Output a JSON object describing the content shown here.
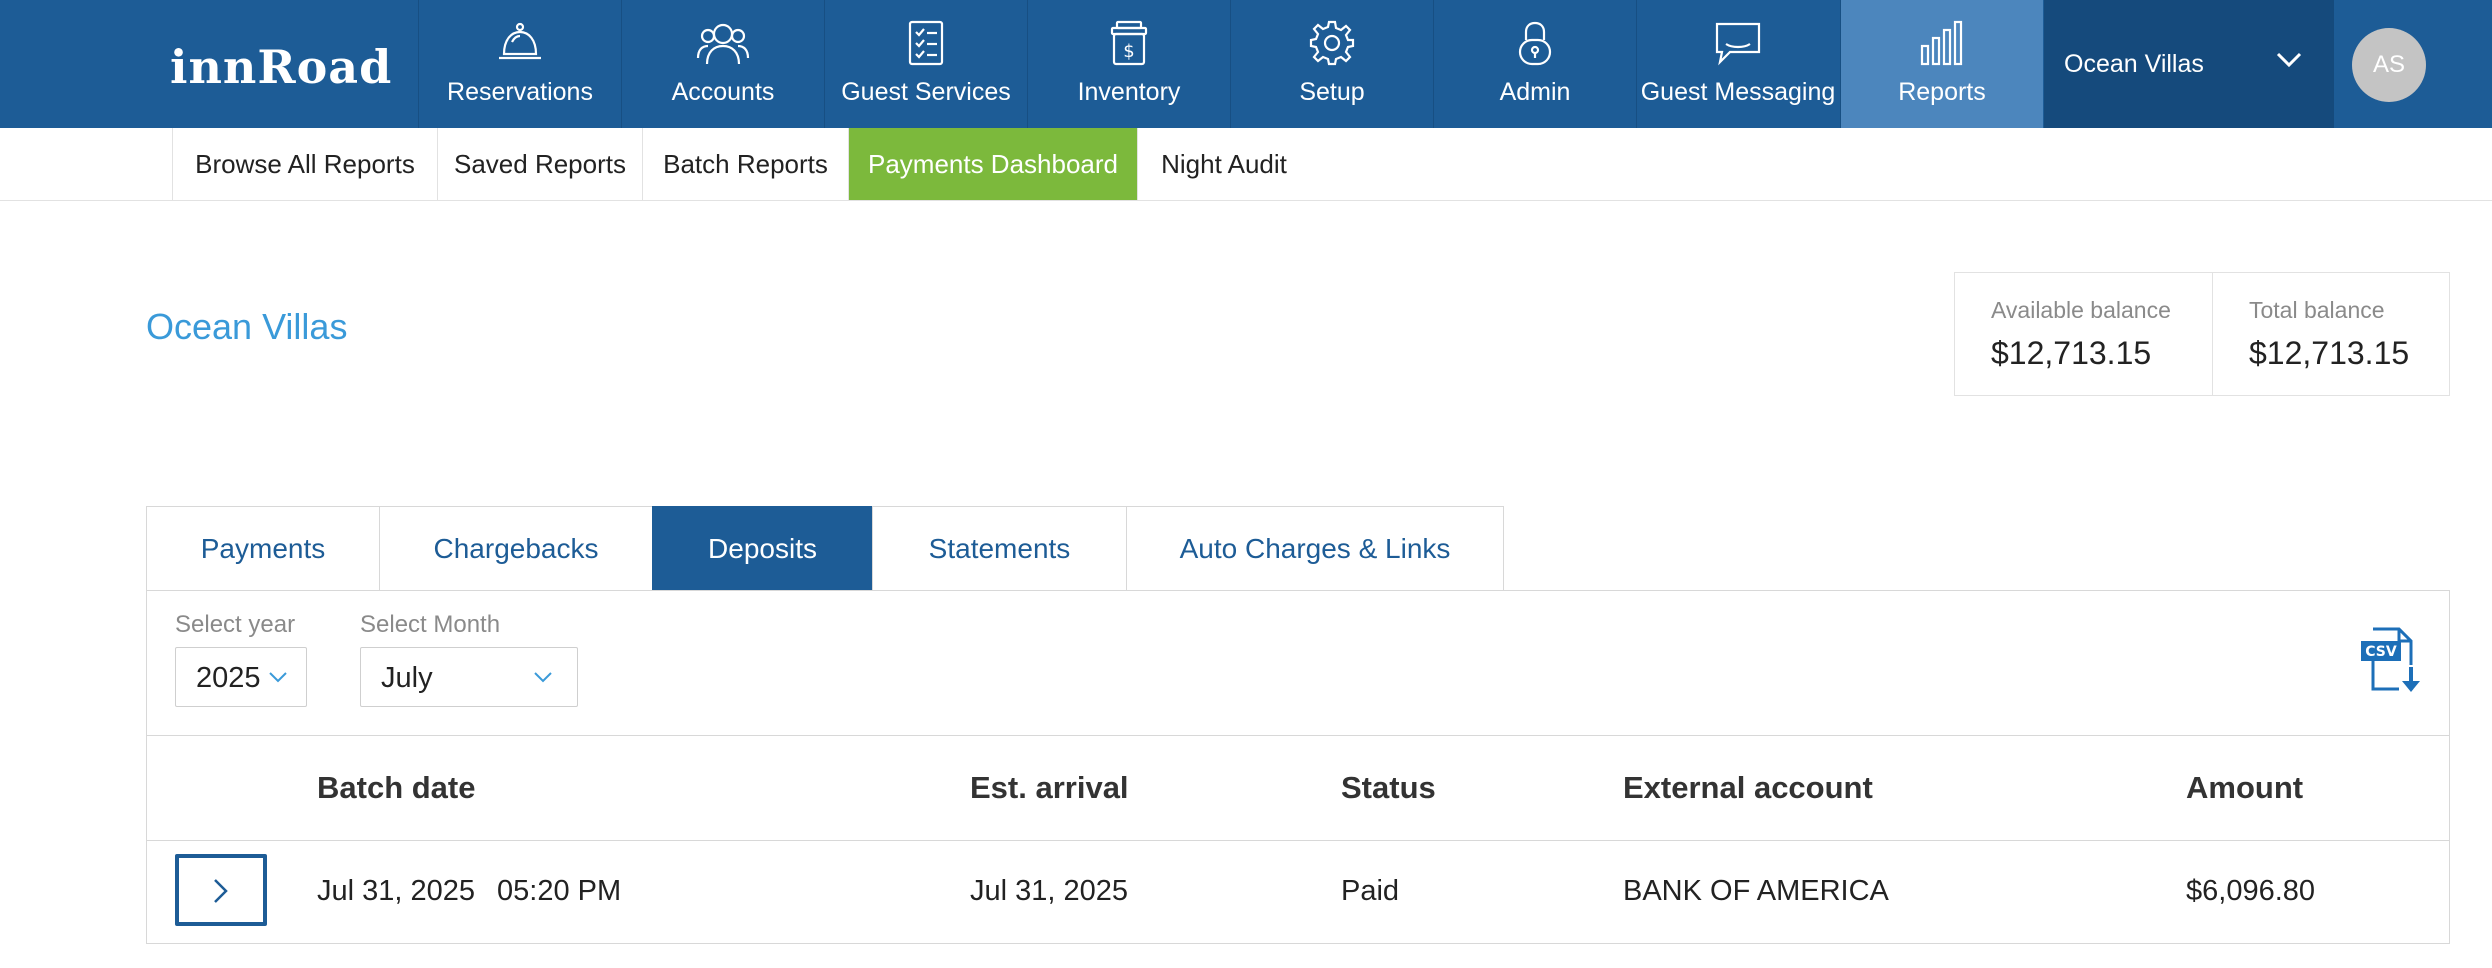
{
  "app": {
    "logo": "innRoad"
  },
  "nav": {
    "items": [
      {
        "label": "Reservations",
        "icon": "bell-icon"
      },
      {
        "label": "Accounts",
        "icon": "users-icon"
      },
      {
        "label": "Guest Services",
        "icon": "checklist-icon"
      },
      {
        "label": "Inventory",
        "icon": "jar-dollar-icon"
      },
      {
        "label": "Setup",
        "icon": "gear-icon"
      },
      {
        "label": "Admin",
        "icon": "lock-icon"
      },
      {
        "label": "Guest Messaging",
        "icon": "chat-icon"
      },
      {
        "label": "Reports",
        "icon": "bar-chart-icon",
        "active": true
      }
    ],
    "property": "Ocean Villas",
    "avatar_initials": "AS"
  },
  "subnav": {
    "items": [
      {
        "label": "Browse All Reports"
      },
      {
        "label": "Saved Reports"
      },
      {
        "label": "Batch Reports"
      },
      {
        "label": "Payments Dashboard",
        "active": true
      },
      {
        "label": "Night Audit"
      }
    ]
  },
  "page": {
    "property_title": "Ocean Villas",
    "balances": [
      {
        "label": "Available balance",
        "value": "$12,713.15"
      },
      {
        "label": "Total balance",
        "value": "$12,713.15"
      }
    ]
  },
  "tabs": [
    {
      "label": "Payments"
    },
    {
      "label": "Chargebacks"
    },
    {
      "label": "Deposits",
      "active": true
    },
    {
      "label": "Statements"
    },
    {
      "label": "Auto Charges & Links"
    }
  ],
  "filters": {
    "year_label": "Select year",
    "year_value": "2025",
    "month_label": "Select Month",
    "month_value": "July",
    "csv_icon": "csv-download-icon"
  },
  "table": {
    "columns": [
      "Batch date",
      "Est. arrival",
      "Status",
      "External account",
      "Amount"
    ],
    "rows": [
      {
        "batch_date": "Jul 31, 2025",
        "batch_time": "05:20 PM",
        "est_arrival": "Jul 31, 2025",
        "status": "Paid",
        "external_account": "BANK OF AMERICA",
        "amount": "$6,096.80"
      }
    ]
  },
  "colors": {
    "nav_bg": "#1d5c96",
    "nav_active": "#4c86bd",
    "subnav_active": "#7cb93c",
    "link_blue": "#3a9ad9"
  }
}
